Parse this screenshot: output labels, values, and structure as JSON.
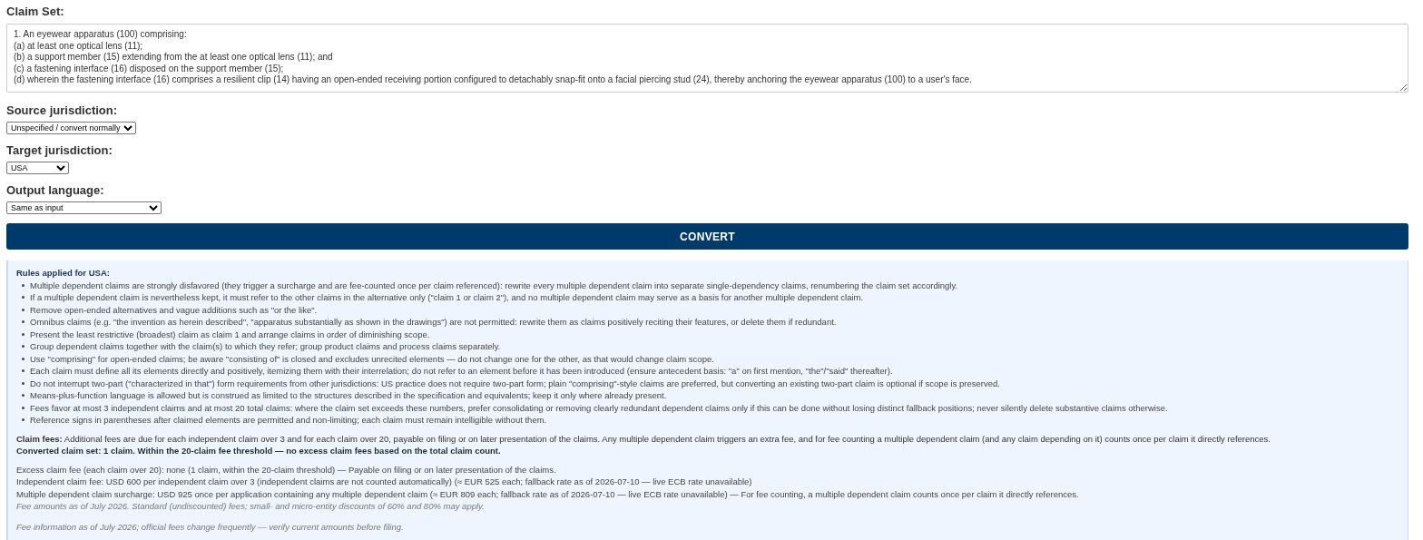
{
  "claim_set": {
    "label": "Claim Set:",
    "value": "1. An eyewear apparatus (100) comprising:\n(a) at least one optical lens (11);\n(b) a support member (15) extending from the at least one optical lens (11); and\n(c) a fastening interface (16) disposed on the support member (15);\n(d) wherein the fastening interface (16) comprises a resilient clip (14) having an open-ended receiving portion configured to detachably snap-fit onto a facial piercing stud (24), thereby anchoring the eyewear apparatus (100) to a user's face."
  },
  "selects": [
    {
      "label": "Source jurisdiction:",
      "value": "Unspecified / convert normally"
    },
    {
      "label": "Target jurisdiction:",
      "value": "USA"
    },
    {
      "label": "Output language:",
      "value": "Same as input"
    }
  ],
  "convert_button": "CONVERT",
  "rules": {
    "title": "Rules applied for USA:",
    "items": [
      "Multiple dependent claims are strongly disfavored (they trigger a surcharge and are fee-counted once per claim referenced): rewrite every multiple dependent claim into separate single-dependency claims, renumbering the claim set accordingly.",
      "If a multiple dependent claim is nevertheless kept, it must refer to the other claims in the alternative only (\"claim 1 or claim 2\"), and no multiple dependent claim may serve as a basis for another multiple dependent claim.",
      "Remove open-ended alternatives and vague additions such as \"or the like\".",
      "Omnibus claims (e.g. \"the invention as herein described\", \"apparatus substantially as shown in the drawings\") are not permitted: rewrite them as claims positively reciting their features, or delete them if redundant.",
      "Present the least restrictive (broadest) claim as claim 1 and arrange claims in order of diminishing scope.",
      "Group dependent claims together with the claim(s) to which they refer; group product claims and process claims separately.",
      "Use \"comprising\" for open-ended claims; be aware \"consisting of\" is closed and excludes unrecited elements — do not change one for the other, as that would change claim scope.",
      "Each claim must define all its elements directly and positively, itemizing them with their interrelation; do not refer to an element before it has been introduced (ensure antecedent basis: \"a\" on first mention, \"the\"/\"said\" thereafter).",
      "Do not interrupt two-part (\"characterized in that\") form requirements from other jurisdictions: US practice does not require two-part form; plain \"comprising\"-style claims are preferred, but converting an existing two-part claim is optional if scope is preserved.",
      "Means-plus-function language is allowed but is construed as limited to the structures described in the specification and equivalents; keep it only where already present.",
      "Fees favor at most 3 independent claims and at most 20 total claims: where the claim set exceeds these numbers, prefer consolidating or removing clearly redundant dependent claims only if this can be done without losing distinct fallback positions; never silently delete substantive claims otherwise.",
      "Reference signs in parentheses after claimed elements are permitted and non-limiting; each claim must remain intelligible without them."
    ],
    "fees_text": "**Claim fees:** Additional fees are due for each independent claim over 3 and for each claim over 20, payable on filing or on later presentation of the claims. Any multiple dependent claim triggers an extra fee, and for fee counting a multiple dependent claim (and any claim depending on it) counts once per claim it directly references.",
    "summary": "Converted claim set: 1 claim. Within the 20-claim fee threshold — no excess claim fees based on the total claim count.",
    "fee_lines": [
      {
        "kind": "plain",
        "text": "Excess claim fee (each claim over 20): none (1 claim, within the 20-claim threshold) — Payable on filing or on later presentation of the claims."
      },
      {
        "kind": "plain",
        "text": "Independent claim fee: USD 600 per independent claim over 3 (independent claims are not counted automatically) (≈ EUR 525 each; fallback rate as of 2026-07-10 — live ECB rate unavailable)"
      },
      {
        "kind": "plain",
        "text": "Multiple dependent claim surcharge: USD 925 once per application containing any multiple dependent claim (≈ EUR 809 each; fallback rate as of 2026-07-10 — live ECB rate unavailable) — For fee counting, a multiple dependent claim counts once per claim it directly references."
      },
      {
        "kind": "note",
        "text": "Fee amounts as of July 2026. Standard (undiscounted) fees; small- and micro-entity discounts of 60% and 80% may apply."
      }
    ],
    "footer": "Fee information as of July 2026; official fees change frequently — verify current amounts before filing."
  }
}
